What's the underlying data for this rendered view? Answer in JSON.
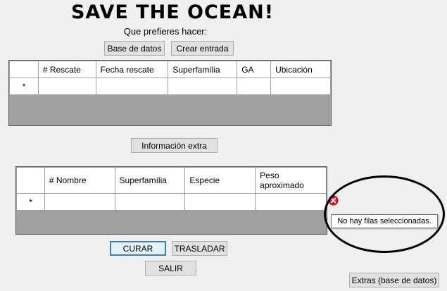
{
  "header": {
    "title": "SAVE THE OCEAN!",
    "subtitle": "Que prefieres hacer:"
  },
  "top_buttons": {
    "database": "Base de datos",
    "create_entry": "Crear entrada"
  },
  "rescue_grid": {
    "columns": [
      "# Rescate",
      "Fecha rescate",
      "Superfamília",
      "GA",
      "Ubicación"
    ],
    "new_row_marker": "*"
  },
  "extra_info_button": "Información extra",
  "species_grid": {
    "columns": [
      "# Nombre",
      "Superfamília",
      "Especie",
      "Peso aproximado"
    ],
    "new_row_marker": "*"
  },
  "error": {
    "icon": "error-x-icon",
    "message": "No hay filas seleccionadas."
  },
  "bottom_buttons": {
    "cure": "CURAR",
    "transfer": "TRASLADAR",
    "exit": "SALIR",
    "extras": "Extras (base de datos)"
  },
  "colors": {
    "grid_background": "#a0a0a0",
    "error_red": "#e81123",
    "focus_border": "#3c7fb1"
  }
}
